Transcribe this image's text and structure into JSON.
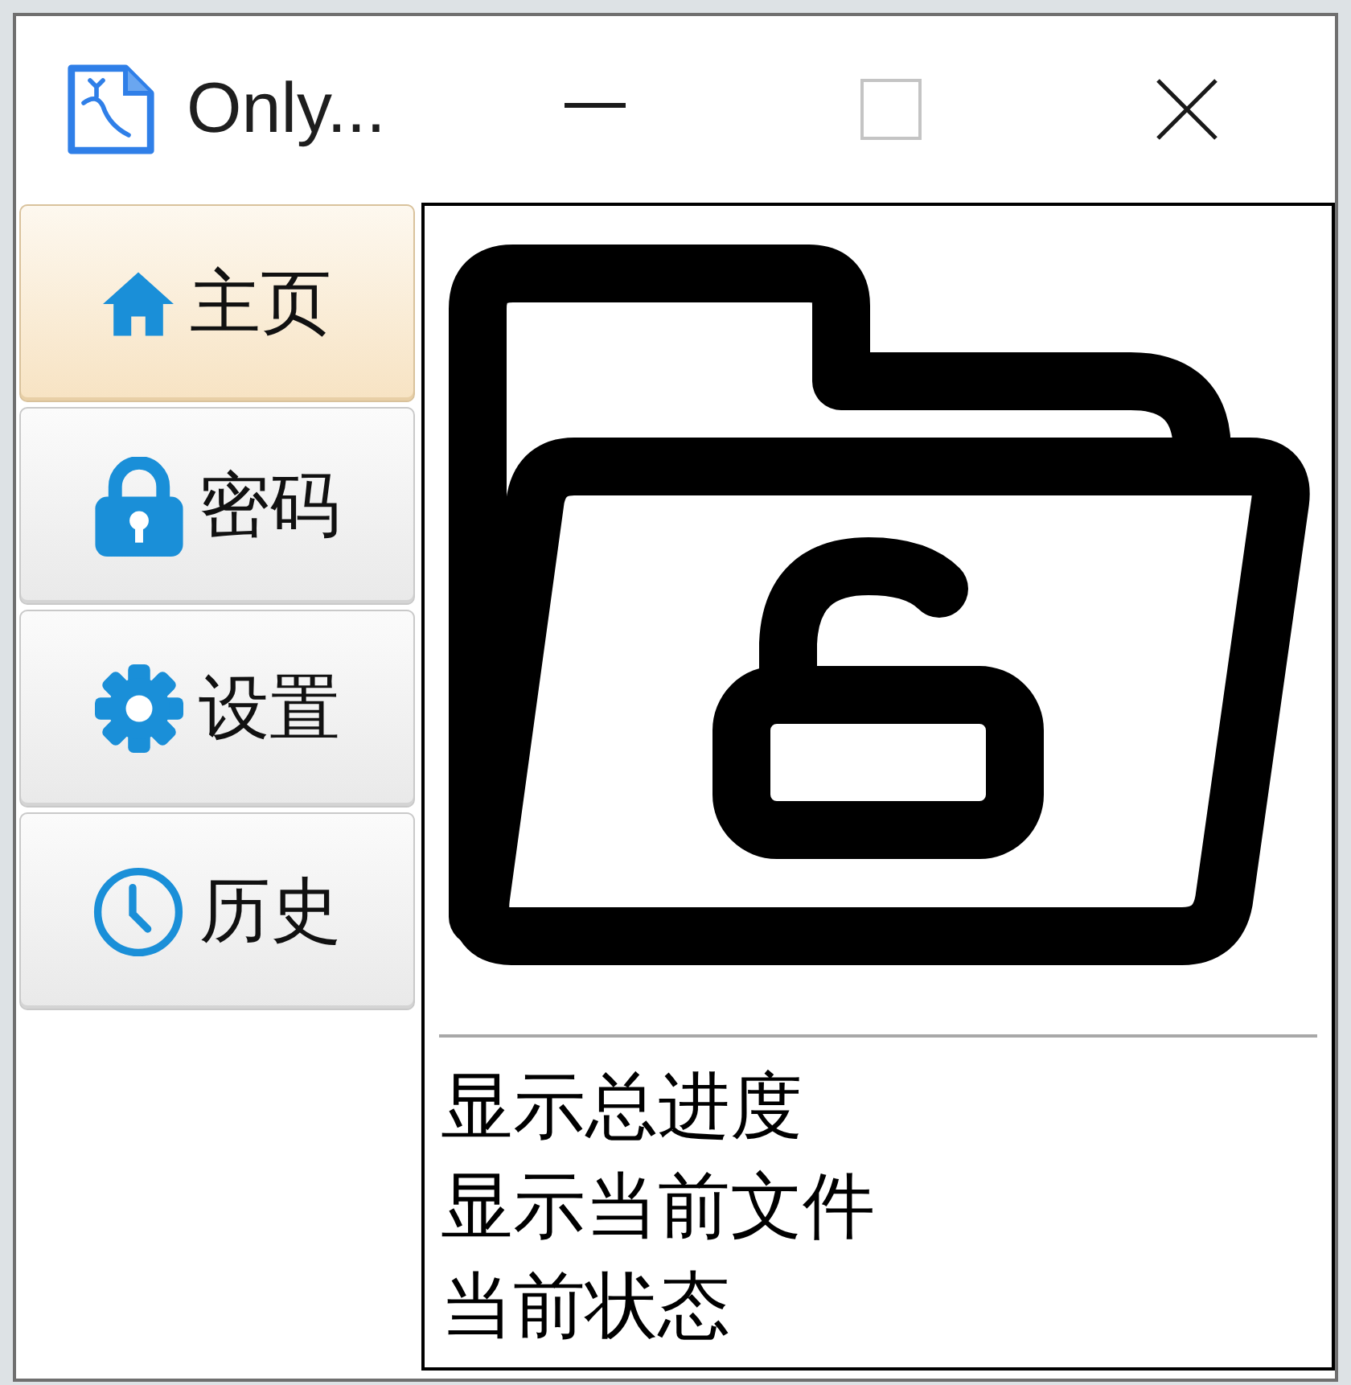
{
  "window": {
    "title": "Only...",
    "controls": [
      {
        "kind": "minimize",
        "disabled": false
      },
      {
        "kind": "maximize",
        "disabled": true
      },
      {
        "kind": "close",
        "disabled": false
      }
    ]
  },
  "sidebar": {
    "items": [
      {
        "label": "主页",
        "selected": true
      },
      {
        "label": "密码",
        "selected": false
      },
      {
        "label": "设置",
        "selected": false
      },
      {
        "label": "历史",
        "selected": false
      }
    ]
  },
  "main": {
    "status_lines": [
      "显示总进度",
      "显示当前文件",
      "当前状态"
    ]
  }
}
